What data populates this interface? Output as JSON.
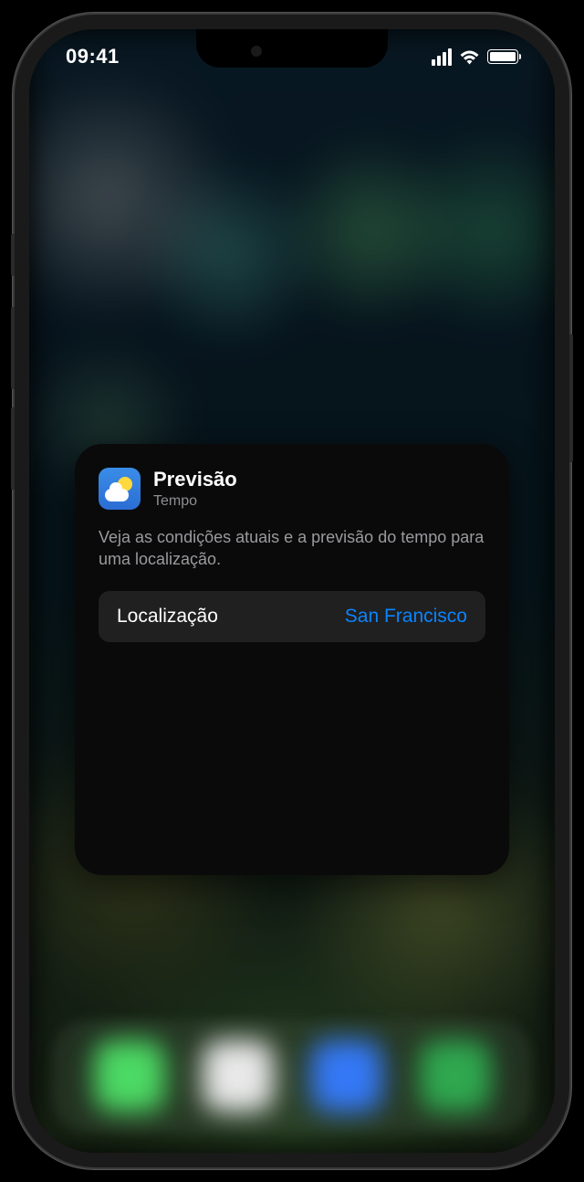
{
  "statusBar": {
    "time": "09:41"
  },
  "widget": {
    "title": "Previsão",
    "appName": "Tempo",
    "description": "Veja as condições atuais e a previsão do tempo para uma localização.",
    "settingRow": {
      "label": "Localização",
      "value": "San Francisco"
    }
  }
}
